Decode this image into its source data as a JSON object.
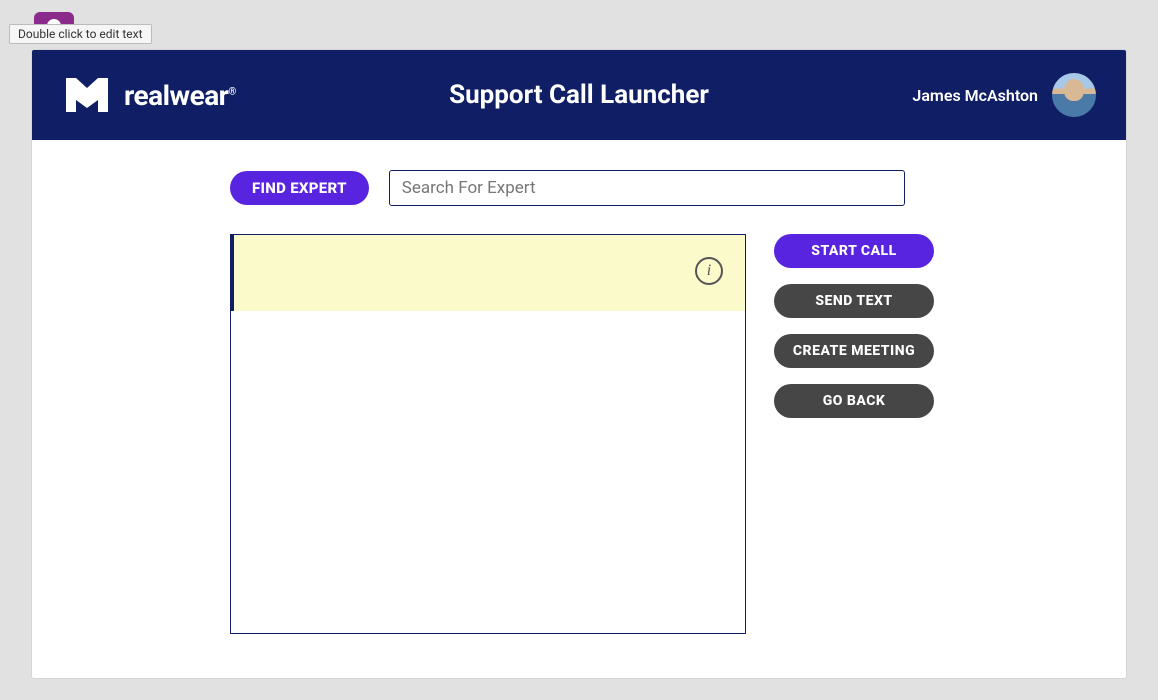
{
  "tooltip": "Double click to edit text",
  "brand": {
    "name": "realwear"
  },
  "header": {
    "title": "Support Call Launcher",
    "user_name": "James McAshton"
  },
  "search": {
    "find_button": "FIND EXPERT",
    "placeholder": "Search For Expert"
  },
  "info_icon_label": "i",
  "actions": {
    "start_call": "START CALL",
    "send_text": "SEND TEXT",
    "create_meeting": "CREATE MEETING",
    "go_back": "GO BACK"
  }
}
